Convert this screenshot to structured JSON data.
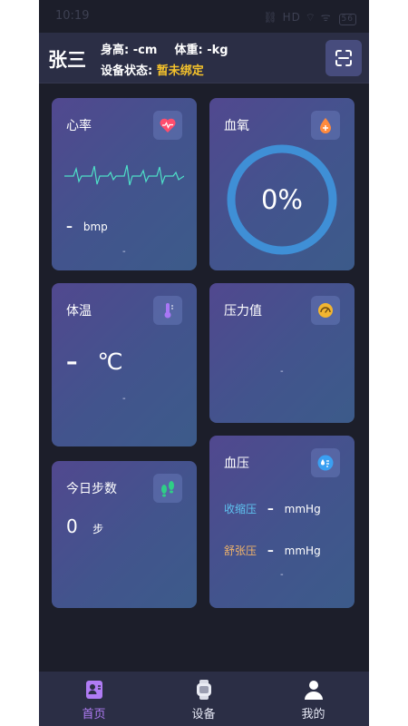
{
  "status_bar": {
    "time": "10:19",
    "indicators": "⛓ HD ⌔ ᯤ",
    "battery": "56"
  },
  "header": {
    "user_name": "张三",
    "height_label": "身高:",
    "height_value": "-cm",
    "weight_label": "体重:",
    "weight_value": "-kg",
    "device_status_label": "设备状态:",
    "device_status_value": "暂未绑定",
    "scan_icon": "scan-icon"
  },
  "cards": {
    "heart_rate": {
      "title": "心率",
      "value": "–",
      "unit": "bmp",
      "sub": "-",
      "icon": "heart-icon"
    },
    "spo2": {
      "title": "血氧",
      "value": "0%",
      "icon": "drop-icon",
      "progress": 0
    },
    "temperature": {
      "title": "体温",
      "value": "–",
      "unit": "℃",
      "sub": "-",
      "icon": "thermometer-icon"
    },
    "stress": {
      "title": "压力值",
      "sub": "-",
      "icon": "gauge-icon"
    },
    "steps": {
      "title": "今日步数",
      "value": "0",
      "unit": "步",
      "icon": "footprints-icon"
    },
    "blood_pressure": {
      "title": "血压",
      "systolic_label": "收缩压",
      "systolic_value": "–",
      "diastolic_label": "舒张压",
      "diastolic_value": "–",
      "unit": "mmHg",
      "sub": "-",
      "icon": "bp-icon"
    }
  },
  "nav": {
    "items": [
      {
        "label": "首页",
        "icon": "home-icon",
        "active": true
      },
      {
        "label": "设备",
        "icon": "watch-icon",
        "active": false
      },
      {
        "label": "我的",
        "icon": "profile-icon",
        "active": false
      }
    ]
  },
  "colors": {
    "background": "#1c1e2a",
    "header": "#2b2e45",
    "accent_yellow": "#f5c22b",
    "accent_purple": "#b07cf5",
    "ecg": "#4ee0c8",
    "ring": "#3f8fd6"
  }
}
